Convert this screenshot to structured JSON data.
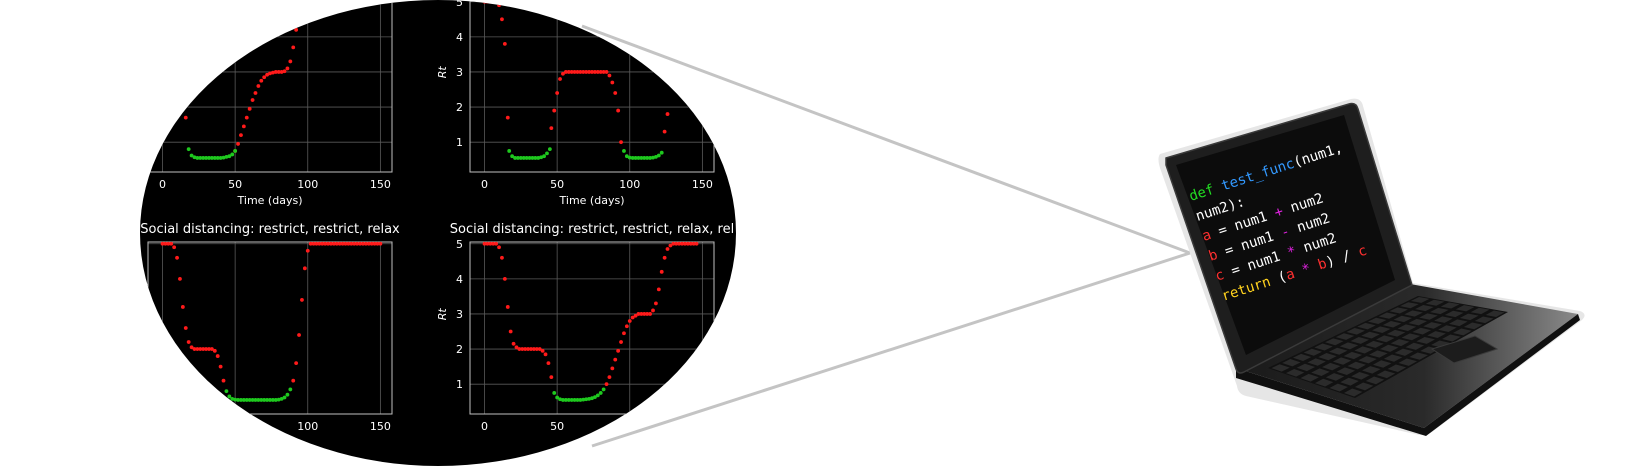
{
  "colors": {
    "plot_background": "#000000",
    "axis_frame": "#bfbfbf",
    "grid": "#5a5a5a",
    "restrict_points": "#ff1a1a",
    "relax_points": "#1ec81e",
    "connector": "#c4c4c4",
    "laptop_body": "#1e1e1e",
    "code_keyword": "#22dd22",
    "code_function": "#3399ff",
    "code_text": "#ffffff",
    "code_var_red": "#ff3030",
    "code_operator": "#dd22dd",
    "code_return": "#ffd21e"
  },
  "chart_data": [
    {
      "type": "scatter",
      "panel": "top-left",
      "title": "",
      "xlabel": "Time (days)",
      "ylabel": "",
      "xticks": [
        "0",
        "50",
        "100",
        "150"
      ],
      "yticks": [],
      "xlim": [
        -10,
        158
      ],
      "ylim": [
        0.15,
        5.05
      ],
      "grid": true,
      "series": [
        {
          "color": "restrict",
          "x": [
            16,
            50,
            52,
            54,
            56,
            58,
            60,
            62,
            64,
            66,
            68,
            70,
            72,
            74,
            76,
            78,
            80,
            82,
            84,
            86,
            88,
            90,
            92,
            94,
            96,
            98,
            100,
            102,
            104
          ],
          "y": [
            1.7,
            0.75,
            0.95,
            1.2,
            1.45,
            1.7,
            1.95,
            2.2,
            2.4,
            2.6,
            2.75,
            2.85,
            2.92,
            2.96,
            2.98,
            3.0,
            3.0,
            3.0,
            3.02,
            3.1,
            3.3,
            3.7,
            4.2,
            4.6,
            4.85,
            5.0,
            5.0,
            5.0,
            5.0
          ]
        },
        {
          "color": "relax",
          "x": [
            18,
            20,
            22,
            24,
            26,
            28,
            30,
            32,
            34,
            36,
            38,
            40,
            42,
            44,
            46,
            48,
            50
          ],
          "y": [
            0.8,
            0.62,
            0.57,
            0.55,
            0.55,
            0.55,
            0.55,
            0.55,
            0.55,
            0.55,
            0.55,
            0.55,
            0.56,
            0.58,
            0.6,
            0.65,
            0.75
          ]
        }
      ]
    },
    {
      "type": "scatter",
      "panel": "top-right",
      "title": "",
      "xlabel": "Time (days)",
      "ylabel": "Rt",
      "xticks": [
        "0",
        "50",
        "100",
        "150"
      ],
      "yticks": [
        "1",
        "2",
        "3",
        "4",
        "5"
      ],
      "xlim": [
        -10,
        158
      ],
      "ylim": [
        0.15,
        5.05
      ],
      "grid": true,
      "series": [
        {
          "color": "restrict",
          "x": [
            0,
            2,
            4,
            6,
            8,
            10,
            12,
            14,
            16,
            46,
            48,
            50,
            52,
            54,
            56,
            58,
            60,
            62,
            64,
            66,
            68,
            70,
            72,
            74,
            76,
            78,
            80,
            82,
            84,
            86,
            88,
            90,
            92,
            94,
            124,
            126
          ],
          "y": [
            5.0,
            5.0,
            5.0,
            5.0,
            5.0,
            4.9,
            4.5,
            3.8,
            1.7,
            1.4,
            1.9,
            2.4,
            2.8,
            2.95,
            3.0,
            3.0,
            3.0,
            3.0,
            3.0,
            3.0,
            3.0,
            3.0,
            3.0,
            3.0,
            3.0,
            3.0,
            3.0,
            3.0,
            3.0,
            2.9,
            2.7,
            2.4,
            1.9,
            1.0,
            1.3,
            1.8
          ]
        },
        {
          "color": "relax",
          "x": [
            17,
            19,
            21,
            23,
            25,
            27,
            29,
            31,
            33,
            35,
            37,
            39,
            41,
            43,
            45,
            96,
            98,
            100,
            102,
            104,
            106,
            108,
            110,
            112,
            114,
            116,
            118,
            120,
            122
          ],
          "y": [
            0.75,
            0.6,
            0.55,
            0.55,
            0.55,
            0.55,
            0.55,
            0.55,
            0.55,
            0.55,
            0.55,
            0.57,
            0.6,
            0.68,
            0.8,
            0.75,
            0.6,
            0.56,
            0.55,
            0.55,
            0.55,
            0.55,
            0.55,
            0.55,
            0.55,
            0.56,
            0.58,
            0.62,
            0.7
          ]
        }
      ]
    },
    {
      "type": "scatter",
      "panel": "bottom-left",
      "title": "Social distancing: restrict, restrict, relax",
      "xlabel": "",
      "ylabel": "",
      "xticks": [
        "0",
        "50",
        "100",
        "150"
      ],
      "yticks": [
        "5"
      ],
      "xlim": [
        -10,
        158
      ],
      "ylim": [
        0.15,
        5.05
      ],
      "grid": true,
      "series": [
        {
          "color": "restrict",
          "x": [
            0,
            2,
            4,
            6,
            8,
            10,
            12,
            14,
            16,
            18,
            20,
            22,
            24,
            26,
            28,
            30,
            32,
            34,
            36,
            38,
            40,
            42,
            90,
            92,
            94,
            96,
            98,
            100,
            102,
            104,
            106,
            108,
            110,
            112,
            114,
            116,
            118,
            120,
            122,
            124,
            126,
            128,
            130,
            132,
            134,
            136,
            138,
            140,
            142,
            144,
            146,
            148,
            150
          ],
          "y": [
            5.0,
            5.0,
            5.0,
            5.0,
            4.9,
            4.6,
            4.0,
            3.2,
            2.6,
            2.2,
            2.05,
            2.0,
            2.0,
            2.0,
            2.0,
            2.0,
            2.0,
            2.0,
            1.95,
            1.8,
            1.5,
            1.1,
            1.1,
            1.6,
            2.4,
            3.4,
            4.3,
            4.8,
            5.0,
            5.0,
            5.0,
            5.0,
            5.0,
            5.0,
            5.0,
            5.0,
            5.0,
            5.0,
            5.0,
            5.0,
            5.0,
            5.0,
            5.0,
            5.0,
            5.0,
            5.0,
            5.0,
            5.0,
            5.0,
            5.0,
            5.0,
            5.0,
            5.0
          ]
        },
        {
          "color": "relax",
          "x": [
            44,
            46,
            48,
            50,
            52,
            54,
            56,
            58,
            60,
            62,
            64,
            66,
            68,
            70,
            72,
            74,
            76,
            78,
            80,
            82,
            84,
            86,
            88
          ],
          "y": [
            0.8,
            0.65,
            0.58,
            0.56,
            0.55,
            0.55,
            0.55,
            0.55,
            0.55,
            0.55,
            0.55,
            0.55,
            0.55,
            0.55,
            0.55,
            0.55,
            0.55,
            0.55,
            0.56,
            0.58,
            0.62,
            0.7,
            0.85
          ]
        }
      ]
    },
    {
      "type": "scatter",
      "panel": "bottom-right",
      "title": "Social distancing: restrict, restrict, relax, rel",
      "xlabel": "",
      "ylabel": "Rt",
      "xticks": [
        "0",
        "50",
        "100",
        "150"
      ],
      "yticks": [
        "1",
        "2",
        "3",
        "4",
        "5"
      ],
      "xlim": [
        -10,
        158
      ],
      "ylim": [
        0.15,
        5.05
      ],
      "grid": true,
      "series": [
        {
          "color": "restrict",
          "x": [
            0,
            2,
            4,
            6,
            8,
            10,
            12,
            14,
            16,
            18,
            20,
            22,
            24,
            26,
            28,
            30,
            32,
            34,
            36,
            38,
            40,
            42,
            44,
            46,
            84,
            86,
            88,
            90,
            92,
            94,
            96,
            98,
            100,
            102,
            104,
            106,
            108,
            110,
            112,
            114,
            116,
            118,
            120,
            122,
            124,
            126,
            128,
            130,
            132,
            134,
            136,
            138,
            140,
            142,
            144,
            146
          ],
          "y": [
            5.0,
            5.0,
            5.0,
            5.0,
            5.0,
            4.9,
            4.6,
            4.0,
            3.2,
            2.5,
            2.15,
            2.05,
            2.0,
            2.0,
            2.0,
            2.0,
            2.0,
            2.0,
            2.0,
            2.0,
            1.95,
            1.85,
            1.6,
            1.2,
            1.0,
            1.2,
            1.45,
            1.7,
            1.95,
            2.2,
            2.45,
            2.65,
            2.8,
            2.9,
            2.95,
            3.0,
            3.0,
            3.0,
            3.0,
            3.0,
            3.1,
            3.3,
            3.7,
            4.2,
            4.6,
            4.85,
            4.95,
            5.0,
            5.0,
            5.0,
            5.0,
            5.0,
            5.0,
            5.0,
            5.0,
            5.0
          ]
        },
        {
          "color": "relax",
          "x": [
            48,
            50,
            52,
            54,
            56,
            58,
            60,
            62,
            64,
            66,
            68,
            70,
            72,
            74,
            76,
            78,
            80,
            82
          ],
          "y": [
            0.75,
            0.62,
            0.57,
            0.55,
            0.55,
            0.55,
            0.55,
            0.55,
            0.55,
            0.55,
            0.56,
            0.57,
            0.58,
            0.6,
            0.63,
            0.68,
            0.75,
            0.85
          ]
        }
      ]
    }
  ],
  "laptop": {
    "screen_code": [
      [
        {
          "t": "def ",
          "c": "code_keyword"
        },
        {
          "t": "test_func",
          "c": "code_function"
        },
        {
          "t": "(num1,",
          "c": "code_text"
        }
      ],
      [
        {
          "t": "num2):",
          "c": "code_text"
        }
      ],
      [
        {
          "t": "    ",
          "c": "code_text"
        },
        {
          "t": "a",
          "c": "code_var_red"
        },
        {
          "t": " = num1 ",
          "c": "code_text"
        },
        {
          "t": "+",
          "c": "code_operator"
        },
        {
          "t": " num2",
          "c": "code_text"
        }
      ],
      [
        {
          "t": "    ",
          "c": "code_text"
        },
        {
          "t": "b",
          "c": "code_var_red"
        },
        {
          "t": " = num1 ",
          "c": "code_text"
        },
        {
          "t": "-",
          "c": "code_operator"
        },
        {
          "t": " num2",
          "c": "code_text"
        }
      ],
      [
        {
          "t": "    ",
          "c": "code_text"
        },
        {
          "t": "c",
          "c": "code_var_red"
        },
        {
          "t": " = num1 ",
          "c": "code_text"
        },
        {
          "t": "*",
          "c": "code_operator"
        },
        {
          "t": " num2",
          "c": "code_text"
        }
      ],
      [
        {
          "t": "    ",
          "c": "code_text"
        },
        {
          "t": "return",
          "c": "code_return"
        },
        {
          "t": " (",
          "c": "code_text"
        },
        {
          "t": "a",
          "c": "code_var_red"
        },
        {
          "t": " ",
          "c": "code_text"
        },
        {
          "t": "*",
          "c": "code_operator"
        },
        {
          "t": " ",
          "c": "code_text"
        },
        {
          "t": "b",
          "c": "code_var_red"
        },
        {
          "t": ") / ",
          "c": "code_text"
        },
        {
          "t": "c",
          "c": "code_var_red"
        }
      ]
    ]
  }
}
